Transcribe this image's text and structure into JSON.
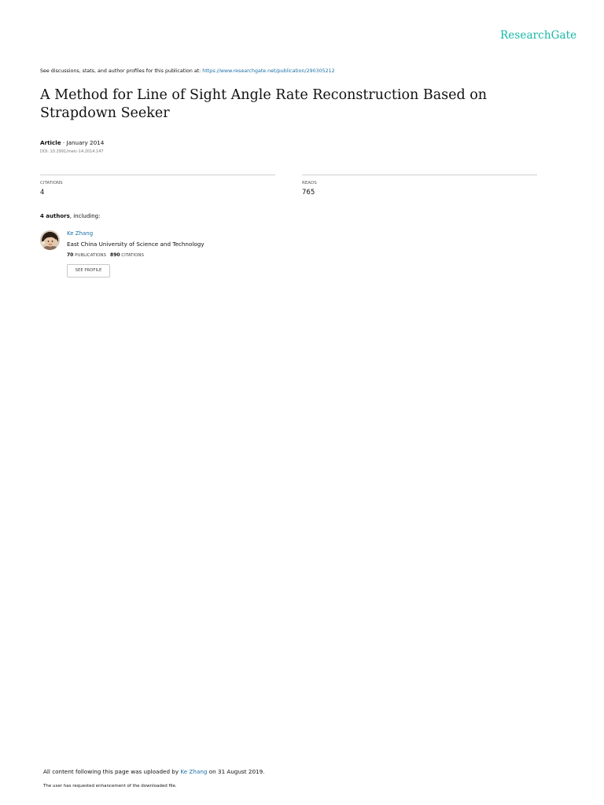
{
  "brand": {
    "name": "ResearchGate",
    "color": "#14b8a6"
  },
  "header": {
    "discussion_prefix": "See discussions, stats, and author profiles for this publication at: ",
    "discussion_url": "https://www.researchgate.net/publication/290305212"
  },
  "publication": {
    "title": "A Method for Line of Sight Angle Rate Reconstruction Based on Strapdown Seeker",
    "type": "Article",
    "date_sep": " · ",
    "date": "January 2014",
    "doi": "DOI: 10.2991/meic-14.2014.147"
  },
  "stats": {
    "citations_label": "CITATIONS",
    "citations_value": "4",
    "reads_label": "READS",
    "reads_value": "765"
  },
  "authors": {
    "count_text": "4 authors",
    "suffix": ", including:",
    "list": [
      {
        "name": "Ke Zhang",
        "affiliation": "East China University of Science and Technology",
        "publications_count": "70",
        "publications_label": "PUBLICATIONS",
        "citations_count": "890",
        "citations_label": "CITATIONS",
        "profile_button": "SEE PROFILE"
      }
    ]
  },
  "footer": {
    "uploaded_prefix": "All content following this page was uploaded by ",
    "uploaded_by": "Ke Zhang",
    "uploaded_suffix": " on 31 August 2019.",
    "enhancement_note": "The user has requested enhancement of the downloaded file."
  },
  "colors": {
    "link": "#1a6fa7",
    "text": "#111111"
  }
}
